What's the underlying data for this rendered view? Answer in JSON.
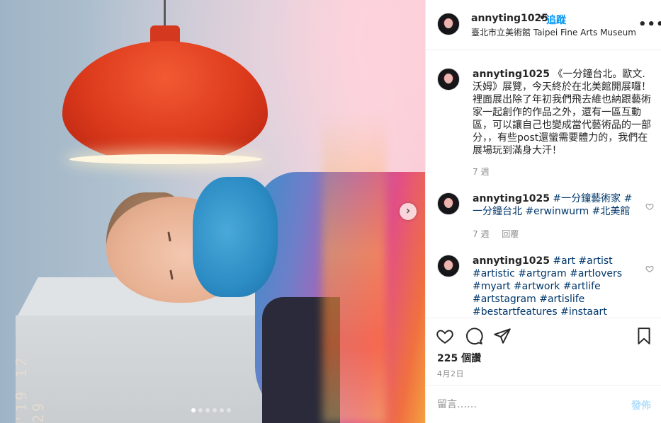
{
  "post": {
    "image": {
      "date_stamp": "'19 12 29",
      "carousel_total": 6,
      "carousel_index": 1
    },
    "header": {
      "username": "annyting1025",
      "dot": "•",
      "follow_label": "追蹤",
      "location": "臺北市立美術館 Taipei Fine Arts Museum",
      "more_icon": "more-options-icon"
    },
    "comments": [
      {
        "username": "annyting1025",
        "text": "《一分鐘台北。歐文.沃姆》展覽，今天終於在北美館開展囉！裡面展出除了年初我們飛去維也納跟藝術家一起創作的作品之外，還有一區互動區，可以讓自己也變成當代藝術品的一部分，，有些post還蠻需要體力的，我們在展場玩到滿身大汗！",
        "time": "7 週",
        "reply": ""
      },
      {
        "username": "annyting1025",
        "text": "#一分鐘藝術家 #一分鐘台北 #erwinwurm #北美館",
        "time": "7 週",
        "reply": "回覆"
      },
      {
        "username": "annyting1025",
        "text": "#art #artist #artistic #artgram #artlovers #myart #artwork #artlife #artstagram #artislife #bestartfeatures #instaart #art_community",
        "time": "",
        "reply": ""
      }
    ],
    "actions": {
      "icons": [
        "heart-icon",
        "comment-icon",
        "share-icon",
        "bookmark-icon"
      ],
      "likes": "225 個讚",
      "date": "4月2日"
    },
    "add_comment": {
      "placeholder": "留言……",
      "post_label": "發佈"
    }
  }
}
